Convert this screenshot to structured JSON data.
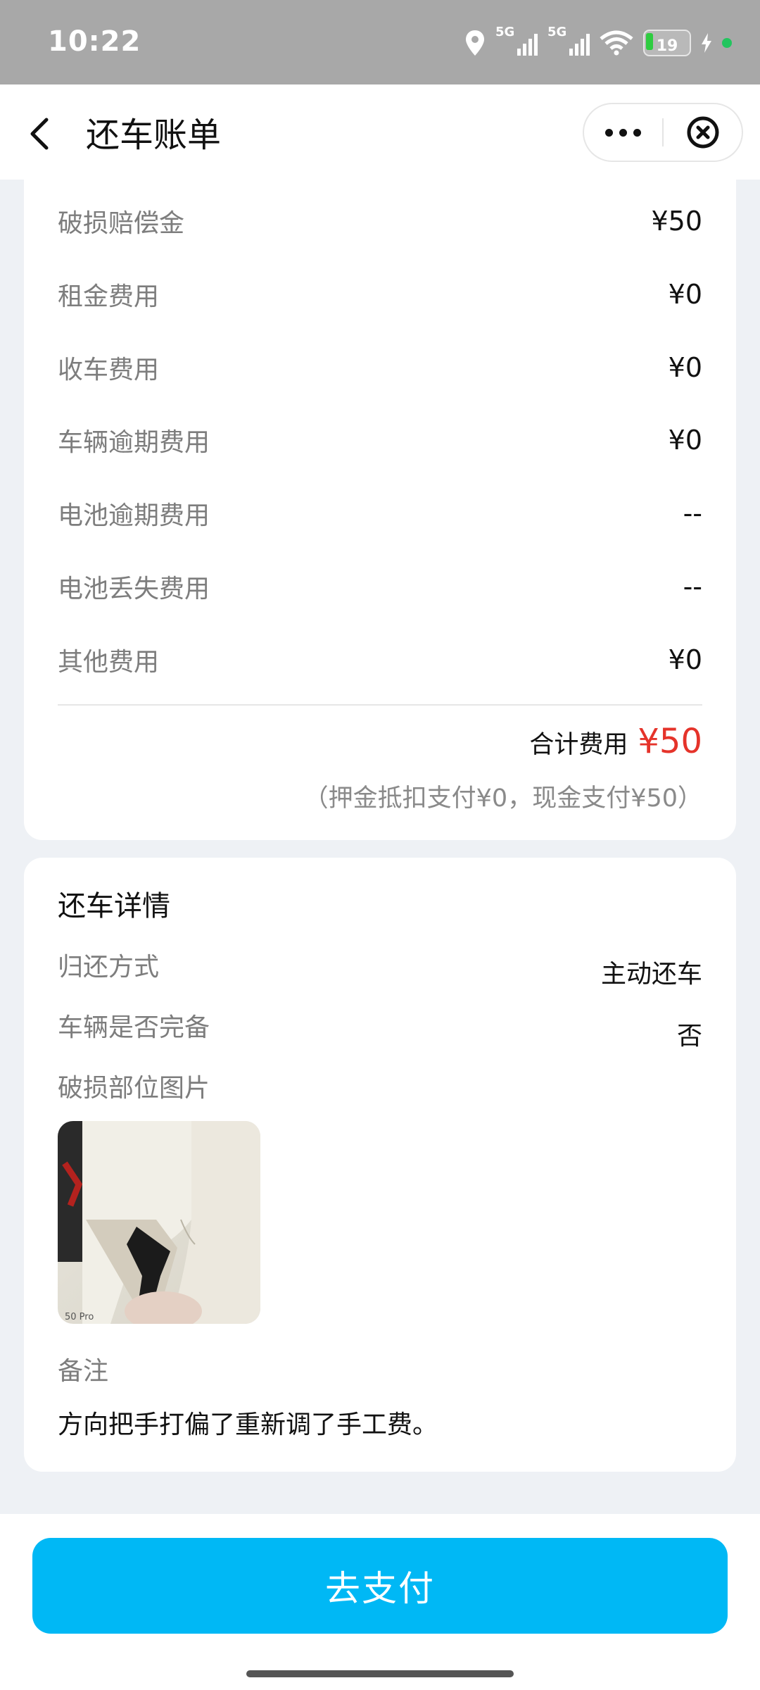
{
  "status_bar": {
    "time": "10:22",
    "network1": "5G",
    "network2": "5G",
    "battery": "19",
    "icons": [
      "location-icon",
      "signal-icon",
      "signal-icon",
      "wifi-icon",
      "battery-icon",
      "charging-icon"
    ]
  },
  "nav": {
    "title": "还车账单"
  },
  "fees": {
    "items": [
      {
        "label": "破损赔偿金",
        "value": "¥50"
      },
      {
        "label": "租金费用",
        "value": "¥0"
      },
      {
        "label": "收车费用",
        "value": "¥0"
      },
      {
        "label": "车辆逾期费用",
        "value": "¥0"
      },
      {
        "label": "电池逾期费用",
        "value": "--"
      },
      {
        "label": "电池丢失费用",
        "value": "--"
      },
      {
        "label": "其他费用",
        "value": "¥0"
      }
    ],
    "total_label": "合计费用",
    "total_value": "¥50",
    "breakdown": "（押金抵扣支付¥0，现金支付¥50）"
  },
  "details": {
    "title": "还车详情",
    "return_method_label": "归还方式",
    "return_method_value": "主动还车",
    "complete_label": "车辆是否完备",
    "complete_value": "否",
    "damage_photo_label": "破损部位图片",
    "remark_label": "备注",
    "remark_value": "方向把手打偏了重新调了手工费。"
  },
  "footer": {
    "pay_button": "去支付"
  },
  "colors": {
    "accent": "#00b8f5",
    "total": "#e5332a"
  }
}
